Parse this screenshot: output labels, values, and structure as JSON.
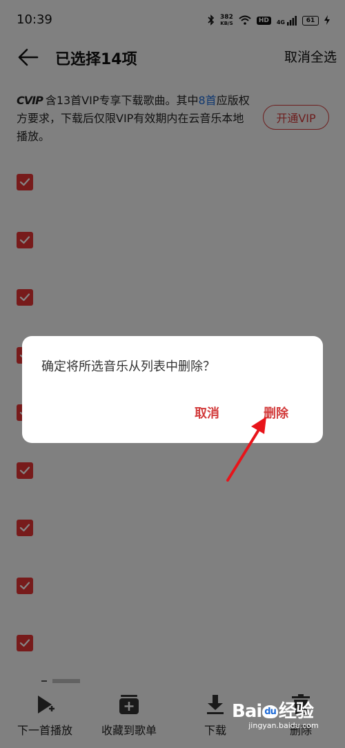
{
  "status_bar": {
    "time": "10:39",
    "net_speed_value": "382",
    "net_speed_unit": "KB/S",
    "hd_badge": "HD",
    "network": "4G",
    "battery": "61"
  },
  "header": {
    "title": "已选择14项",
    "cancel_all": "取消全选"
  },
  "vip_notice": {
    "logo": "CVIP",
    "text_before": "含13首VIP专享下载歌曲。其中",
    "highlight": "8首",
    "text_after": "应版权方要求，下载后仅限VIP有效期内在云音乐本地播放。",
    "button": "开通VIP"
  },
  "checked_count": 9,
  "toolbar": {
    "items": [
      {
        "label": "下一首播放",
        "icon": "play-next-icon"
      },
      {
        "label": "收藏到歌单",
        "icon": "add-to-playlist-icon"
      },
      {
        "label": "下载",
        "icon": "download-icon"
      },
      {
        "label": "删除",
        "icon": "trash-icon"
      }
    ]
  },
  "dialog": {
    "message": "确定将所选音乐从列表中删除？",
    "cancel": "取消",
    "confirm": "删除"
  },
  "watermark": {
    "main": "Bai",
    "paw": "du",
    "cn": "经验",
    "sub": "jingyan.baidu.com"
  },
  "colors": {
    "accent": "#e53535",
    "link": "#1f6bd6",
    "overlay": "rgba(0,0,0,0.48)"
  }
}
